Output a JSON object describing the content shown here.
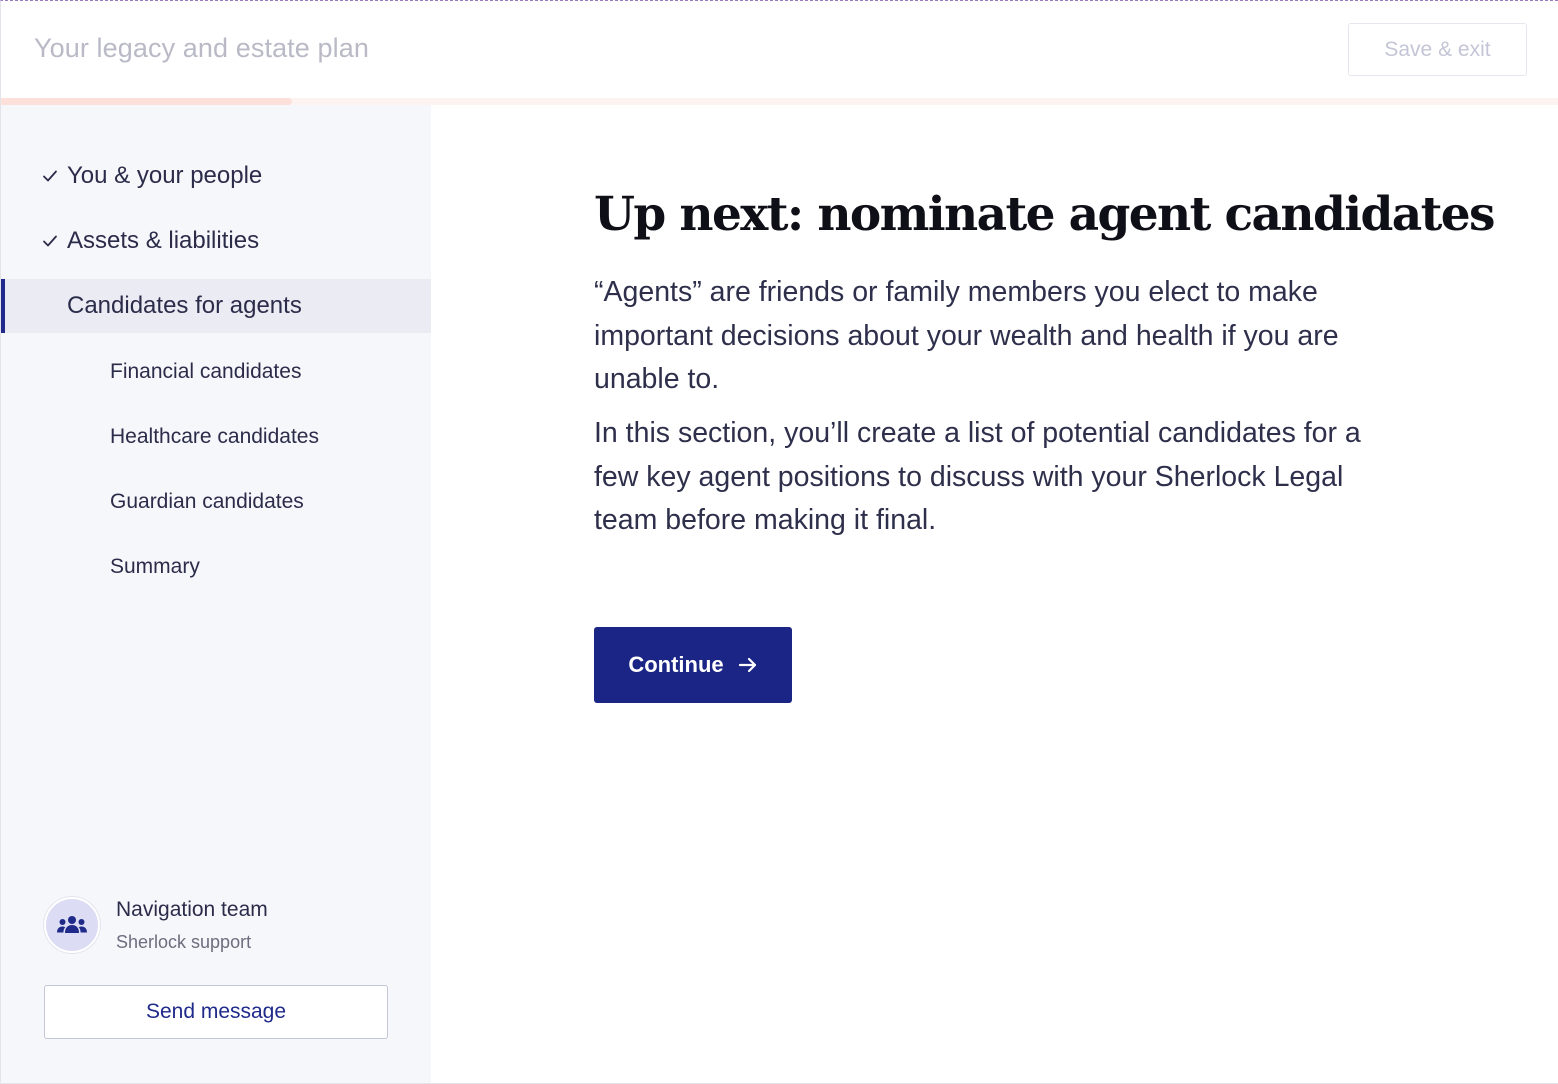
{
  "header": {
    "title": "Your legacy and estate plan",
    "save_exit_label": "Save & exit"
  },
  "progress": {
    "fraction": 0.187
  },
  "sidebar": {
    "items": [
      {
        "label": "You & your people",
        "completed": true,
        "level": "top"
      },
      {
        "label": "Assets & liabilities",
        "completed": true,
        "level": "top"
      },
      {
        "label": "Candidates for agents",
        "completed": false,
        "active": true,
        "level": "top"
      },
      {
        "label": "Financial candidates",
        "level": "sub"
      },
      {
        "label": "Healthcare candidates",
        "level": "sub"
      },
      {
        "label": "Guardian candidates",
        "level": "sub"
      },
      {
        "label": "Summary",
        "level": "sub"
      }
    ],
    "support": {
      "name": "Navigation team",
      "subtitle": "Sherlock support",
      "icon": "team-icon",
      "button_label": "Send message"
    }
  },
  "main": {
    "heading": "Up next: nominate agent candidates",
    "paragraphs": [
      "“Agents” are friends or family members you elect to make important decisions about your wealth and health if you are unable to.",
      "In this section, you’ll create a list of potential candidates for a few key agent positions to discuss with your Sherlock Legal team before making it final."
    ],
    "continue_label": "Continue",
    "continue_icon": "arrow-right-icon"
  },
  "colors": {
    "accent": "#1b2585",
    "sidebar_bg": "#f6f7fa",
    "active_bg": "#ebebf3",
    "progress_fill": "#fde0da",
    "progress_track": "#fdf3f1"
  }
}
